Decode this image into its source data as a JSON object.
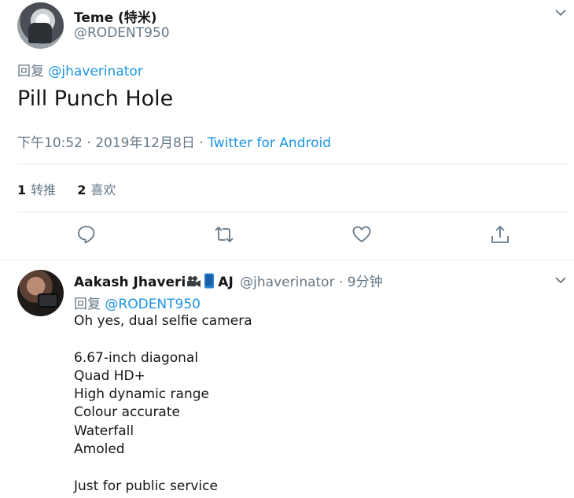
{
  "main_tweet": {
    "author_name": "Teme (特米)",
    "author_handle": "@RODENT950",
    "replying_label": "回复",
    "replying_to": "@jhaverinator",
    "text": "Pill Punch Hole",
    "timestamp": "下午10:52 · 2019年12月8日 · ",
    "source": "Twitter for Android",
    "retweets_count": "1",
    "retweets_label": "转推",
    "likes_count": "2",
    "likes_label": "喜欢",
    "actions": [
      "reply-icon",
      "retweet-icon",
      "like-icon",
      "share-icon"
    ]
  },
  "reply_tweet": {
    "author_name": "Aakash Jhaveri",
    "author_suffix": "AJ",
    "author_handle": "@jhaverinator",
    "time": " · 9分钟",
    "replying_label": "回复",
    "replying_to": "@RODENT950",
    "lines": [
      "Oh yes, dual selfie camera",
      "",
      "6.67-inch diagonal",
      "Quad HD+",
      "High dynamic range",
      "Colour accurate",
      "Waterfall",
      "Amoled",
      "",
      "Just for public service"
    ]
  },
  "colors": {
    "link": "#1b95e0",
    "secondary_text": "#657786",
    "primary_text": "#14171a",
    "divider": "#e1e8ed"
  }
}
